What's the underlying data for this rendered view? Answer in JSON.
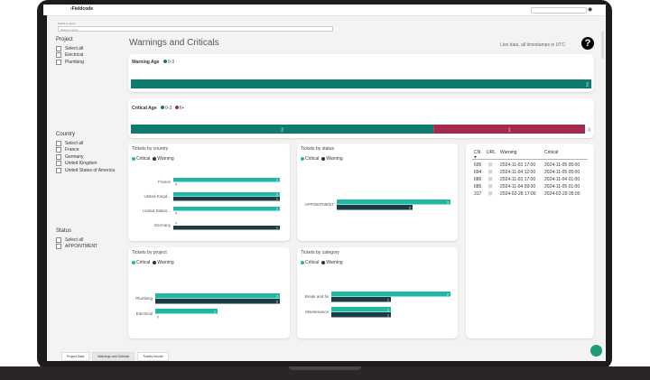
{
  "app": {
    "brand": "Fieldcode",
    "search_placeholder": "Search",
    "user_icon": "user-icon"
  },
  "filter": {
    "label": "Select a report",
    "value": "Select a report"
  },
  "page_title": "Warnings and Criticals",
  "live_note": "Live data, all timestamps in UTC",
  "help": "?",
  "slicers": {
    "project": {
      "title": "Project",
      "items": [
        "Select all",
        "Electrical",
        "Plumbing"
      ]
    },
    "country": {
      "title": "Country",
      "items": [
        "Select all",
        "France",
        "Germany",
        "United Kingdom",
        "United States of America"
      ]
    },
    "status": {
      "title": "Status",
      "items": [
        "Select all",
        "APPOINTMENT"
      ]
    }
  },
  "colors": {
    "critical": "#20b8a5",
    "warning": "#1c3b44",
    "age_teal": "#0f7a6e",
    "age_red": "#a5294d"
  },
  "warning_age": {
    "title": "Warning Age",
    "legend": [
      "0-3"
    ],
    "value": "2",
    "value_num": 2
  },
  "critical_age": {
    "title": "Critical Age",
    "legend": [
      "0-3",
      "6+"
    ],
    "values": [
      "2",
      "1"
    ],
    "nums": [
      2,
      1
    ],
    "total": "3"
  },
  "legend": {
    "critical": "Critical",
    "warning": "Warning"
  },
  "chart_data": [
    {
      "type": "bar",
      "title": "Tickets by country",
      "categories": [
        "France",
        "United Kingd...",
        "United States...",
        "Germany"
      ],
      "series": [
        {
          "name": "Critical",
          "values": [
            1,
            1,
            1,
            0
          ]
        },
        {
          "name": "Warning",
          "values": [
            0,
            1,
            0,
            1
          ]
        }
      ],
      "max": 1
    },
    {
      "type": "bar",
      "title": "Tickets by status",
      "categories": [
        "APPOINTMENT"
      ],
      "series": [
        {
          "name": "Critical",
          "values": [
            3
          ]
        },
        {
          "name": "Warning",
          "values": [
            2
          ]
        }
      ],
      "max": 3
    },
    {
      "type": "bar",
      "title": "Tickets by project",
      "categories": [
        "Plumbing",
        "Electrical"
      ],
      "series": [
        {
          "name": "Critical",
          "values": [
            2,
            1
          ]
        },
        {
          "name": "Warning",
          "values": [
            2,
            0
          ]
        }
      ],
      "max": 2
    },
    {
      "type": "bar",
      "title": "Tickets by category",
      "categories": [
        "Break and fix",
        "Maintenance"
      ],
      "series": [
        {
          "name": "Critical",
          "values": [
            2,
            1
          ]
        },
        {
          "name": "Warning",
          "values": [
            1,
            1
          ]
        }
      ],
      "max": 2
    }
  ],
  "table": {
    "headers": [
      "CN",
      "URL",
      "Warning",
      "Critical"
    ],
    "rows": [
      [
        "695",
        "2024-11-03 17:00",
        "2024-11-05 05:00"
      ],
      [
        "694",
        "2024-11-04 12:00",
        "2024-11-05 05:00"
      ],
      [
        "686",
        "2024-11-03 17:00",
        "2024-11-04 01:00"
      ],
      [
        "685",
        "2024-11-04 09:00",
        "2024-11-05 01:00"
      ],
      [
        "317",
        "2024-02-28 17:00",
        "2024-02-29 05:00"
      ]
    ]
  },
  "tabs": [
    "Project Data",
    "Warnings and Criticals",
    "Tickets Insurer"
  ]
}
